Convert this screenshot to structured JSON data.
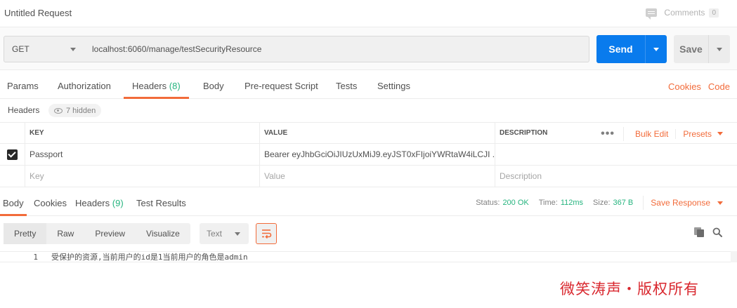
{
  "request": {
    "title": "Untitled Request",
    "comments_label": "Comments",
    "comments_count": "0"
  },
  "url_bar": {
    "method": "GET",
    "url": "localhost:6060/manage/testSecurityResource",
    "send_label": "Send",
    "save_label": "Save"
  },
  "request_tabs": {
    "params": "Params",
    "authorization": "Authorization",
    "headers": "Headers",
    "headers_count": "(8)",
    "body": "Body",
    "prerequest": "Pre-request Script",
    "tests": "Tests",
    "settings": "Settings",
    "cookies_link": "Cookies",
    "code_link": "Code"
  },
  "headers_section": {
    "label": "Headers",
    "hidden_label": "7 hidden",
    "columns": {
      "key": "KEY",
      "value": "VALUE",
      "description": "DESCRIPTION"
    },
    "more": "•••",
    "bulk_edit": "Bulk Edit",
    "presets": "Presets",
    "rows": [
      {
        "checked": true,
        "key": "Passport",
        "value": "Bearer eyJhbGciOiJIUzUxMiJ9.eyJST0xFIjoiYWRtaW4iLCJI ...",
        "description": ""
      }
    ],
    "placeholder": {
      "key": "Key",
      "value": "Value",
      "description": "Description"
    }
  },
  "response_tabs": {
    "body": "Body",
    "cookies": "Cookies",
    "headers": "Headers",
    "headers_count": "(9)",
    "test_results": "Test Results"
  },
  "response_status": {
    "status_label": "Status:",
    "status_value": "200 OK",
    "time_label": "Time:",
    "time_value": "112ms",
    "size_label": "Size:",
    "size_value": "367 B",
    "save_response": "Save Response"
  },
  "body_toolbar": {
    "pretty": "Pretty",
    "raw": "Raw",
    "preview": "Preview",
    "visualize": "Visualize",
    "format": "Text"
  },
  "response_body": {
    "line_number": "1",
    "line_text": "受保护的资源,当前用户的id是1当前用户的角色是admin"
  },
  "watermark": "微笑涛声・版权所有",
  "colors": {
    "accent": "#f26b3a",
    "send": "#097bed",
    "success": "#26b47f",
    "watermark": "#d9272e"
  }
}
